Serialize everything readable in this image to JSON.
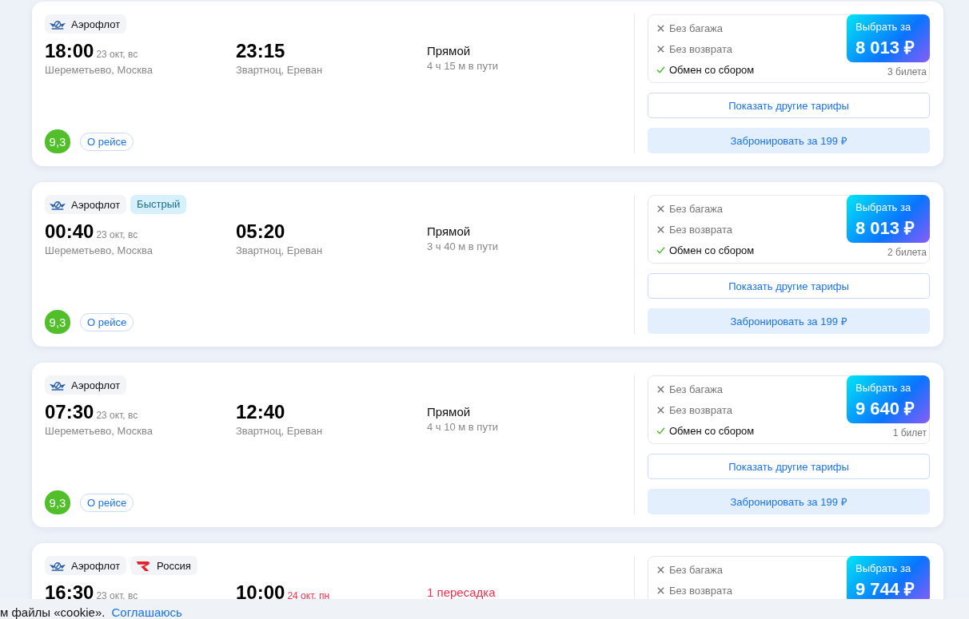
{
  "flights": [
    {
      "airlines": [
        {
          "name": "Аэрофлот",
          "kind": "aeroflot"
        }
      ],
      "departure": {
        "time": "18:00",
        "date": "23 окт, вс",
        "airport": "Шереметьево, Москва"
      },
      "arrival": {
        "time": "23:15",
        "airport": "Звартноц, Ереван"
      },
      "route": {
        "label": "Прямой",
        "kind": "direct",
        "duration": "4 ч 15 м в пути"
      },
      "rating": "9,3",
      "details_button": "О рейсе",
      "fare": {
        "features": [
          {
            "text": "Без багажа",
            "included": false
          },
          {
            "text": "Без возврата",
            "included": false
          },
          {
            "text": "Обмен со сбором",
            "included": true
          }
        ],
        "select_label": "Выбрать за",
        "price": "8 013 ₽",
        "tickets": "3 билета"
      },
      "other_fares_button": "Показать другие тарифы",
      "book_button": "Забронировать за 199 ₽"
    },
    {
      "airlines": [
        {
          "name": "Аэрофлот",
          "kind": "aeroflot"
        }
      ],
      "tags": [
        "Быстрый"
      ],
      "departure": {
        "time": "00:40",
        "date": "23 окт, вс",
        "airport": "Шереметьево, Москва"
      },
      "arrival": {
        "time": "05:20",
        "airport": "Звартноц, Ереван"
      },
      "route": {
        "label": "Прямой",
        "kind": "direct",
        "duration": "3 ч 40 м в пути"
      },
      "rating": "9,3",
      "details_button": "О рейсе",
      "fare": {
        "features": [
          {
            "text": "Без багажа",
            "included": false
          },
          {
            "text": "Без возврата",
            "included": false
          },
          {
            "text": "Обмен со сбором",
            "included": true
          }
        ],
        "select_label": "Выбрать за",
        "price": "8 013 ₽",
        "tickets": "2 билета"
      },
      "other_fares_button": "Показать другие тарифы",
      "book_button": "Забронировать за 199 ₽"
    },
    {
      "airlines": [
        {
          "name": "Аэрофлот",
          "kind": "aeroflot"
        }
      ],
      "departure": {
        "time": "07:30",
        "date": "23 окт, вс",
        "airport": "Шереметьево, Москва"
      },
      "arrival": {
        "time": "12:40",
        "airport": "Звартноц, Ереван"
      },
      "route": {
        "label": "Прямой",
        "kind": "direct",
        "duration": "4 ч 10 м в пути"
      },
      "rating": "9,3",
      "details_button": "О рейсе",
      "fare": {
        "features": [
          {
            "text": "Без багажа",
            "included": false
          },
          {
            "text": "Без возврата",
            "included": false
          },
          {
            "text": "Обмен со сбором",
            "included": true
          }
        ],
        "select_label": "Выбрать за",
        "price": "9 640 ₽",
        "tickets": "1 билет"
      },
      "other_fares_button": "Показать другие тарифы",
      "book_button": "Забронировать за 199 ₽"
    },
    {
      "airlines": [
        {
          "name": "Аэрофлот",
          "kind": "aeroflot"
        },
        {
          "name": "Россия",
          "kind": "rossiya"
        }
      ],
      "departure": {
        "time": "16:30",
        "date": "23 окт, вс"
      },
      "arrival": {
        "time": "10:00",
        "date": "24 окт, пн"
      },
      "route": {
        "label": "1 пересадка",
        "kind": "transfer"
      },
      "fare": {
        "features": [
          {
            "text": "Без багажа",
            "included": false
          },
          {
            "text": "Без возврата",
            "included": false
          }
        ],
        "select_label": "Выбрать за",
        "price": "9 744 ₽"
      }
    }
  ],
  "cookie_banner": {
    "text": "м файлы «cookie».",
    "accept_link": "Соглашаюсь"
  }
}
